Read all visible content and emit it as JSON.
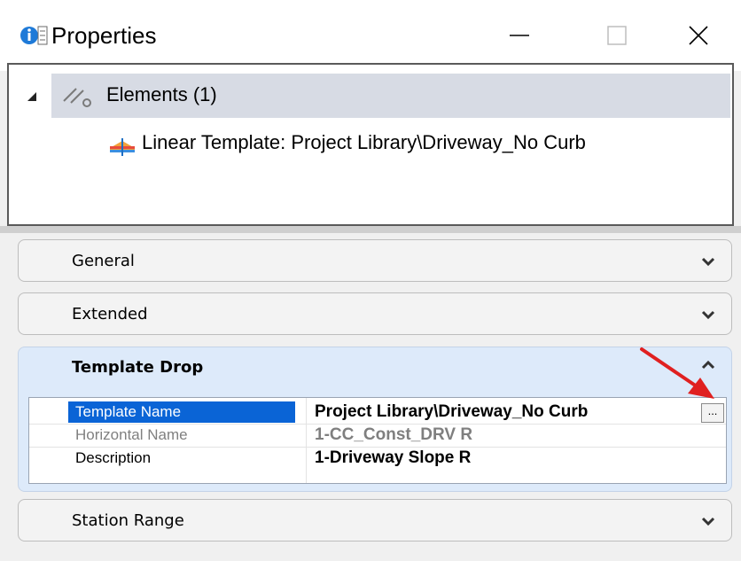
{
  "window": {
    "title": "Properties",
    "controls": {
      "minimize": "minimize-icon",
      "maximize": "maximize-icon",
      "close": "close-icon"
    }
  },
  "tree": {
    "root": {
      "label": "Elements (1)",
      "icon": "elements-icon",
      "expanded": true
    },
    "child": {
      "label": "Linear Template: Project Library\\Driveway_No Curb",
      "icon": "linear-template-icon"
    }
  },
  "sections": {
    "general": {
      "label": "General",
      "expanded": false
    },
    "extended": {
      "label": "Extended",
      "expanded": false
    },
    "template_drop": {
      "label": "Template Drop",
      "expanded": true
    },
    "station_range": {
      "label": "Station Range",
      "expanded": false
    }
  },
  "template_drop_rows": [
    {
      "name": "Template Name",
      "value": "Project Library\\Driveway_No Curb",
      "selected": true,
      "editable": true,
      "button": "..."
    },
    {
      "name": "Horizontal Name",
      "value": "1-CC_Const_DRV R",
      "selected": false,
      "editable": false
    },
    {
      "name": "Description",
      "value": "1-Driveway Slope R",
      "selected": false,
      "editable": true
    }
  ],
  "colors": {
    "selection": "#0a64d6",
    "section_active": "#ddeafa",
    "annotation_arrow": "#e02020",
    "tree_highlight": "#d7dbe4"
  }
}
